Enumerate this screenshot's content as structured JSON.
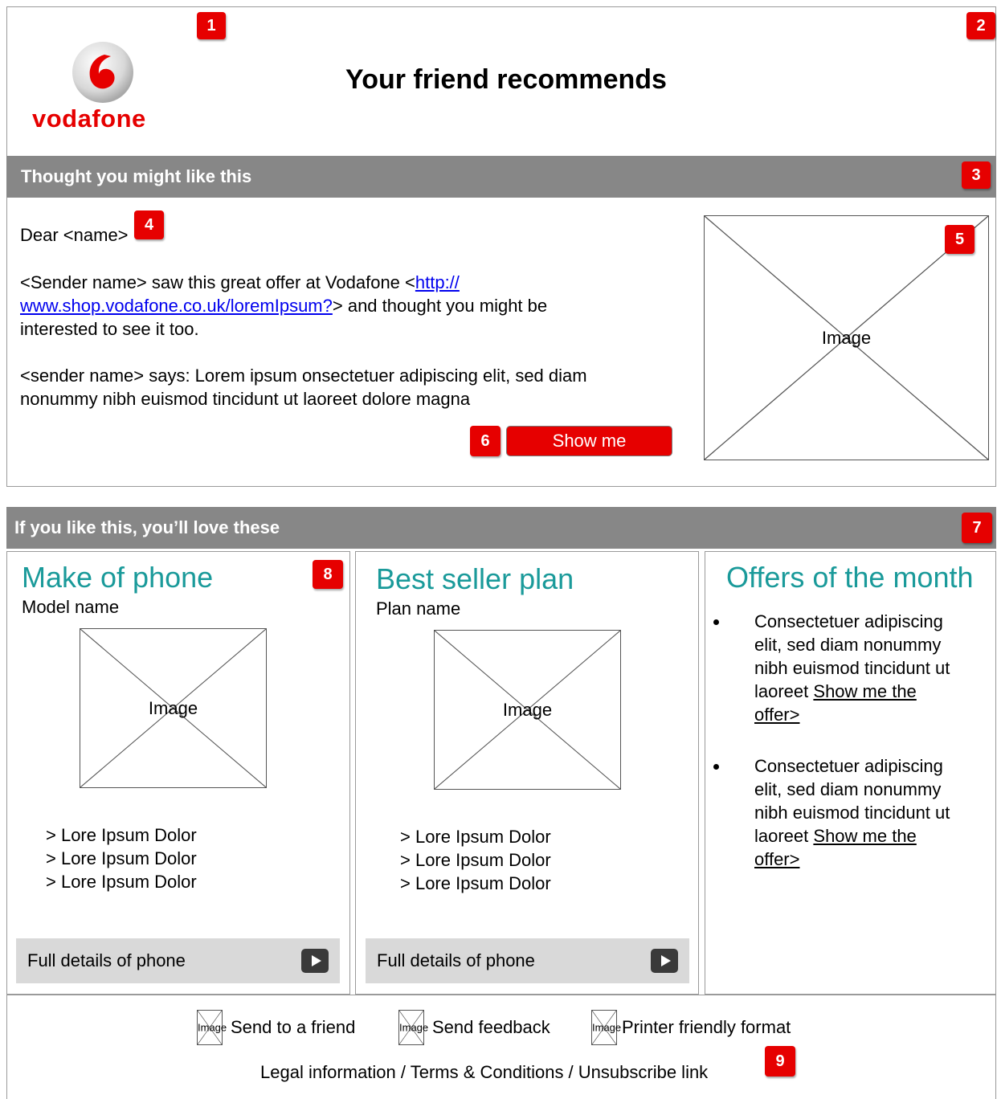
{
  "header": {
    "logo_text": "vodafone",
    "title": "Your friend recommends"
  },
  "badges": [
    "1",
    "2",
    "3",
    "4",
    "5",
    "6",
    "7",
    "8",
    "9"
  ],
  "intro": {
    "bar_title": "Thought you might like this",
    "greeting": "Dear <name>",
    "para1_before": "<Sender name> saw this great offer at Vodafone <",
    "para1_link_line1": "http://",
    "para1_link_line2": "www.shop.vodafone.co.uk/loremIpsum?",
    "para1_after": "> and thought you might be",
    "para1_line3": "interested to see it too.",
    "para2_line1": "<sender name> says: Lorem ipsum onsectetuer adipiscing elit, sed diam",
    "para2_line2": "nonummy nibh euismod tincidunt ut laoreet dolore magna",
    "image_label": "Image",
    "cta_label": "Show me"
  },
  "related": {
    "bar_title": "If you like this, you’ll love these",
    "col1": {
      "heading": "Make of phone",
      "subheading": "Model name",
      "image_label": "Image",
      "items": [
        "> Lore Ipsum Dolor",
        "> Lore Ipsum Dolor",
        "> Lore Ipsum Dolor"
      ],
      "details_label": "Full details of phone"
    },
    "col2": {
      "heading": "Best seller plan",
      "subheading": "Plan name",
      "image_label": "Image",
      "items": [
        "> Lore Ipsum Dolor",
        "> Lore Ipsum Dolor",
        "> Lore Ipsum Dolor"
      ],
      "details_label": "Full details of phone"
    },
    "col3": {
      "heading": "Offers of the month",
      "offers": [
        {
          "lines": [
            "Consectetuer adipiscing",
            "elit, sed diam nonummy",
            "nibh euismod tincidunt ut",
            "laoreet "
          ],
          "link_a": "Show me the",
          "link_b": "offer>"
        },
        {
          "lines": [
            "Consectetuer adipiscing",
            "elit, sed diam nonummy",
            "nibh euismod tincidunt ut",
            "laoreet "
          ],
          "link_a": "Show me the",
          "link_b": "offer>"
        }
      ]
    }
  },
  "footer": {
    "image_label": "Image",
    "send_friend": "Send to a friend",
    "send_feedback": "Send feedback",
    "printer_friendly": "Printer friendly format",
    "legal": "Legal information / Terms & Conditions / Unsubscribe link"
  },
  "colors": {
    "brand_red": "#e60000",
    "bar_gray": "#878787",
    "heading_teal": "#1a9a9a",
    "detail_gray": "#d9d9d9"
  }
}
